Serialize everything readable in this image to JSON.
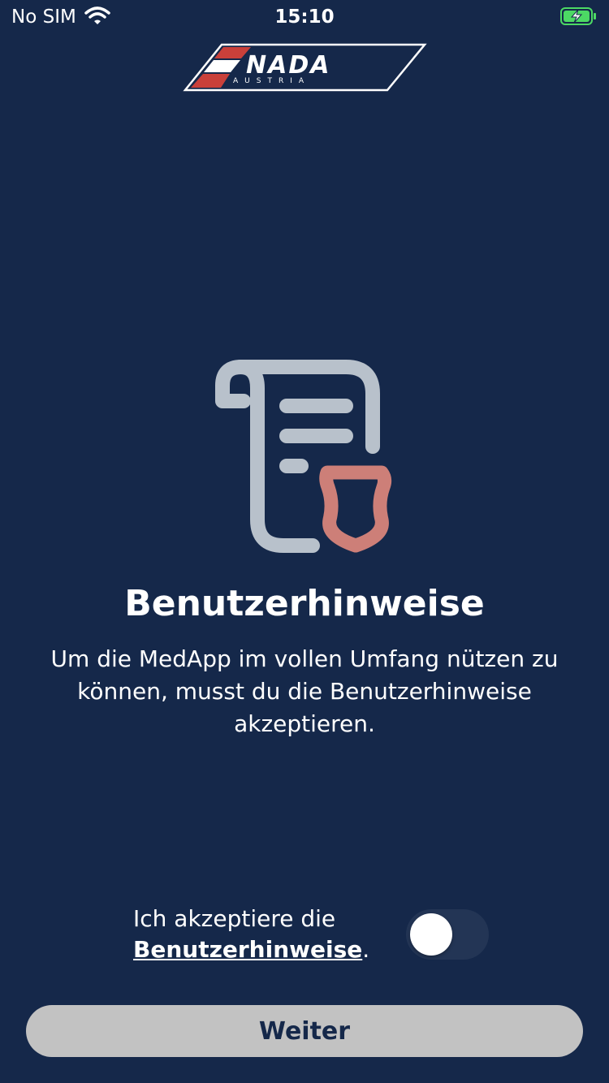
{
  "status_bar": {
    "carrier": "No SIM",
    "time": "15:10",
    "battery_charging": true
  },
  "logo": {
    "text": "NADA",
    "subtext": "AUSTRIA"
  },
  "main": {
    "title": "Benutzerhinweise",
    "description": "Um die MedApp im vollen Umfang nützen zu können, musst du die Benutzerhinweise akzeptieren.",
    "icon": "document-shield-icon"
  },
  "consent": {
    "prefix": "Ich akzeptiere die",
    "link": "Benutzerhinweise",
    "suffix": ".",
    "toggle_on": false
  },
  "next_button": {
    "label": "Weiter"
  },
  "colors": {
    "background": "#15284a",
    "icon": "#b8c1cb",
    "shield": "#cd7f78",
    "button": "#c2c2c2"
  }
}
